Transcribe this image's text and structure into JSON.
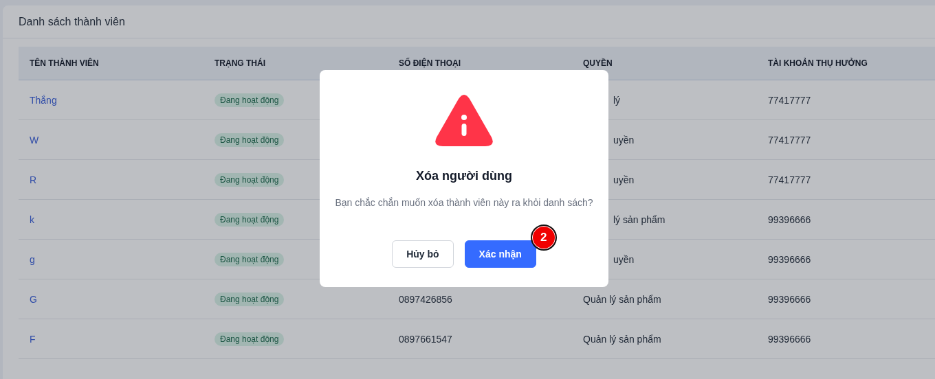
{
  "card": {
    "title": "Danh sách thành viên"
  },
  "table": {
    "columns": [
      "TÊN THÀNH VIÊN",
      "TRẠNG THÁI",
      "SỐ ĐIỆN THOẠI",
      "QUYỀN",
      "TÀI KHOẢN THỤ HƯỞNG"
    ],
    "rows": [
      {
        "name": "Thắng",
        "status": "Đang hoạt động",
        "role": {
          "text": "lý",
          "covered": true
        },
        "account": "77417777"
      },
      {
        "name": "W",
        "status": "Đang hoạt động",
        "role": {
          "text": "uyền",
          "covered": true
        },
        "account": "77417777"
      },
      {
        "name": "R",
        "status": "Đang hoạt động",
        "role": {
          "text": "uyền",
          "covered": true
        },
        "account": "77417777"
      },
      {
        "name": "k",
        "status": "Đang hoạt động",
        "role": {
          "text": "lý sản phẩm",
          "covered": true
        },
        "account": "99396666"
      },
      {
        "name": "g",
        "status": "Đang hoạt động",
        "role": {
          "text": "uyền",
          "covered": true
        },
        "account": "99396666"
      },
      {
        "name": "G",
        "status": "Đang hoạt động",
        "phone": "0897426856",
        "role": {
          "text": "Quản lý sản phẩm"
        },
        "account": "99396666"
      },
      {
        "name": "F",
        "status": "Đang hoạt động",
        "phone": "0897661547",
        "role": {
          "text": "Quản lý sản phẩm"
        },
        "account": "99396666"
      }
    ]
  },
  "dialog": {
    "title": "Xóa người dùng",
    "message": "Bạn chắc chắn muốn xóa thành viên này ra khỏi danh sách?",
    "buttons": [
      {
        "label": "Hủy bỏ",
        "kind": "secondary"
      },
      {
        "label": "Xác nhận",
        "kind": "primary"
      }
    ],
    "step_badge": "2"
  }
}
